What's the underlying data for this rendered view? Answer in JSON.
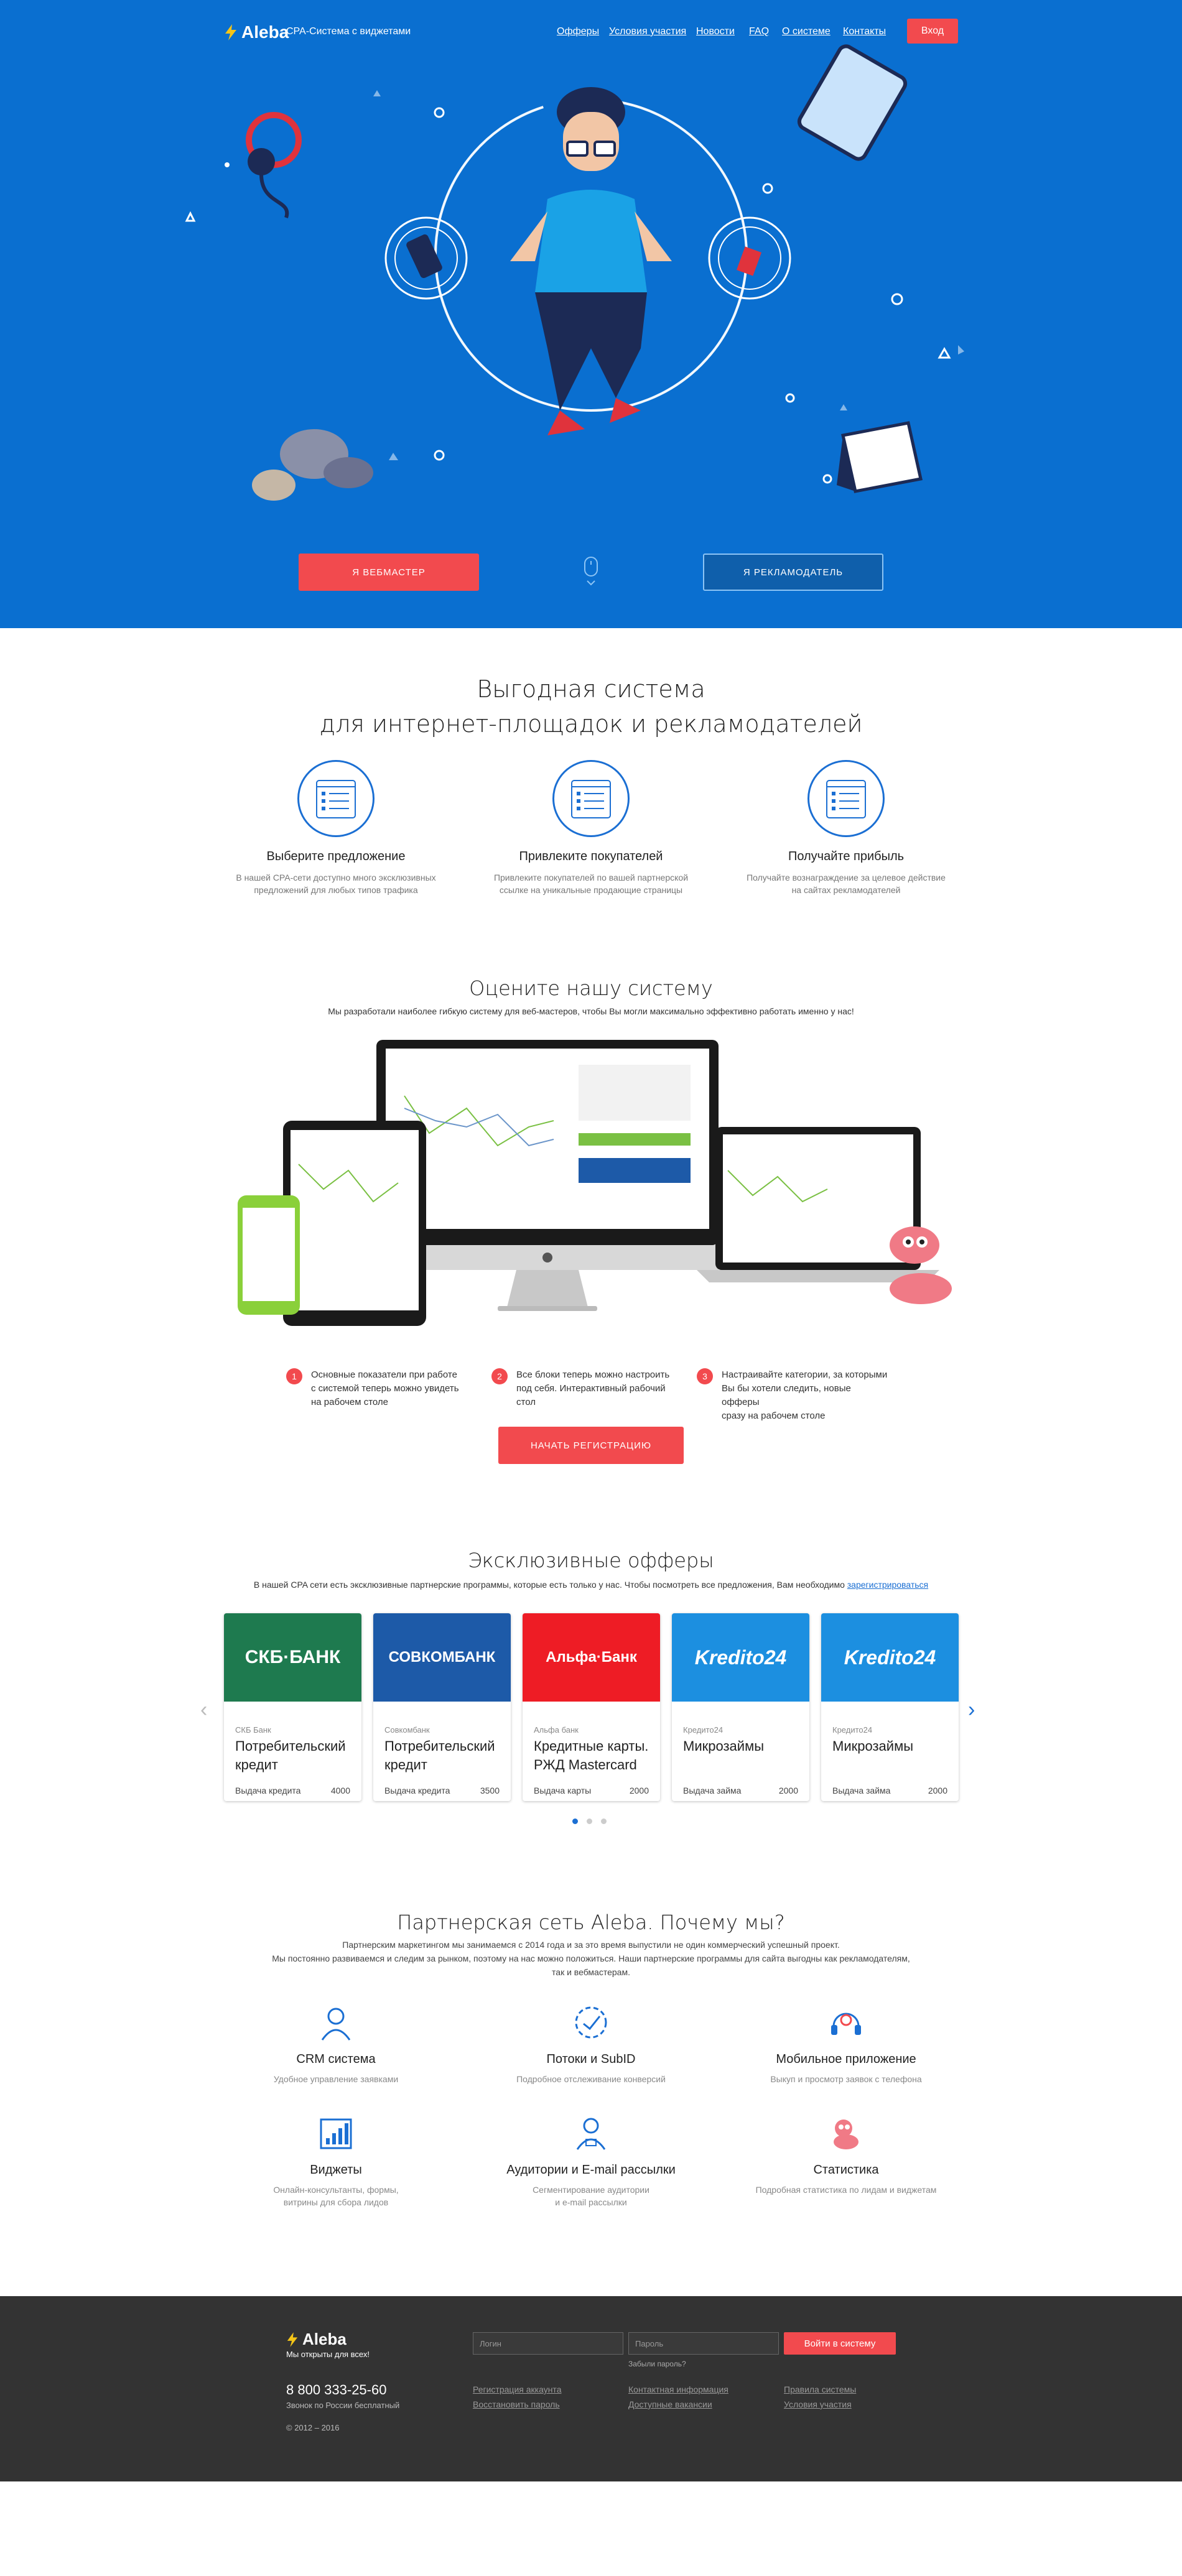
{
  "nav": {
    "logo": "Aleba",
    "tagline": "CPA-Система с виджетами",
    "items": [
      "Офферы",
      "Условия участия",
      "Новости",
      "FAQ",
      "О системе",
      "Контакты"
    ],
    "login": "Вход"
  },
  "hero": {
    "btn_webmaster": "Я ВЕБМАСТЕР",
    "btn_advertiser": "Я РЕКЛАМОДАТЕЛЬ"
  },
  "benefits": {
    "title1": "Выгодная система",
    "title2": "для интернет-площадок и рекламодателей",
    "items": [
      {
        "title": "Выберите предложение",
        "desc1": "В нашей CPA-сети доступно много эксклюзивных",
        "desc2": "предложений для любых типов трафика"
      },
      {
        "title": "Привлеките покупателей",
        "desc1": "Привлеките покупателей по вашей партнерской",
        "desc2": "ссылке на уникальные продающие страницы"
      },
      {
        "title": "Получайте прибыль",
        "desc1": "Получайте вознаграждение за целевое действие",
        "desc2": "на сайтах рекламодателей"
      }
    ]
  },
  "evaluate": {
    "title": "Оцените нашу систему",
    "subtitle": "Мы разработали наиболее гибкую систему для веб-мастеров, чтобы Вы могли максимально эффективно работать именно у нас!",
    "steps": [
      {
        "n": "1",
        "l1": "Основные показатели при работе",
        "l2": "с системой теперь можно увидеть",
        "l3": "на рабочем столе"
      },
      {
        "n": "2",
        "l1": "Все блоки теперь можно настроить",
        "l2": "под себя. Интерактивный рабочий",
        "l3": "стол"
      },
      {
        "n": "3",
        "l1": "Настраивайте категории, за которыми",
        "l2": "Вы бы хотели следить, новые офферы",
        "l3": "сразу на рабочем столе"
      }
    ],
    "register": "НАЧАТЬ РЕГИСТРАЦИЮ"
  },
  "offers": {
    "title": "Эксклюзивные офферы",
    "subtitle": "В нашей CPA сети есть эксклюзивные партнерские программы, которые есть только у нас. Чтобы посмотреть все предложения, Вам необходимо",
    "subtitle_link": "зарегистрироваться",
    "cards": [
      {
        "banner": "СКБ·БАНК",
        "bank": "СКБ Банк",
        "name1": "Потребительский",
        "name2": "кредит",
        "label": "Выдача кредита",
        "value": "4000",
        "color": "#1e7a4f"
      },
      {
        "banner": "СОВКОМБАНК",
        "bank": "Совкомбанк",
        "name1": "Потребительский",
        "name2": "кредит",
        "label": "Выдача кредита",
        "value": "3500",
        "color": "#1d5aa8"
      },
      {
        "banner": "Альфа·Банк",
        "bank": "Альфа банк",
        "name1": "Кредитные карты.",
        "name2": "РЖД Mastercard",
        "label": "Выдача карты",
        "value": "2000",
        "color": "#ee1c25"
      },
      {
        "banner": "Kredito24",
        "bank": "Кредито24",
        "name1": "Микрозаймы",
        "name2": "",
        "label": "Выдача займа",
        "value": "2000",
        "color": "#1c8fe0"
      },
      {
        "banner": "Kredito24",
        "bank": "Кредито24",
        "name1": "Микрозаймы",
        "name2": "",
        "label": "Выдача займа",
        "value": "2000",
        "color": "#1c8fe0"
      }
    ]
  },
  "why": {
    "title": "Партнерская сеть Aleba. Почему мы?",
    "line1": "Партнерским маркетингом мы занимаемся с 2014 года и за это время выпустили не один коммерческий успешный проект.",
    "line2": "Мы постоянно развиваемся и следим за рынком, поэтому на нас можно положиться. Наши партнерские программы для сайта выгодны как рекламодателям,",
    "line3": "так и вебмастерам.",
    "items": [
      {
        "title": "CRM система",
        "d1": "Удобное управление заявками",
        "d2": "",
        "icon": "crm-icon"
      },
      {
        "title": "Потоки и SubID",
        "d1": "Подробное отслеживание конверсий",
        "d2": "",
        "icon": "flow-icon"
      },
      {
        "title": "Мобильное приложение",
        "d1": "Выкуп и просмотр заявок с телефона",
        "d2": "",
        "icon": "headset-icon"
      },
      {
        "title": "Виджеты",
        "d1": "Онлайн-консультанты, формы,",
        "d2": "витрины для сбора лидов",
        "icon": "widget-icon"
      },
      {
        "title": "Аудитории и E-mail рассылки",
        "d1": "Сегментирование аудитории",
        "d2": "и e-mail рассылки",
        "icon": "audience-icon"
      },
      {
        "title": "Статистика",
        "d1": "Подробная статистика по лидам и виджетам",
        "d2": "",
        "icon": "stats-icon"
      }
    ]
  },
  "footer": {
    "logo": "Aleba",
    "slogan": "Мы открыты для всех!",
    "phone": "8 800 333-25-60",
    "phone_note": "Звонок по России бесплатный",
    "copyright": "© 2012 – 2016",
    "login_placeholder": "Логин",
    "password_placeholder": "Пароль",
    "forgot": "Забыли пароль?",
    "login_btn": "Войти в систему",
    "links": [
      "Регистрация аккаунта",
      "Восстановить пароль",
      "Контактная информация",
      "Доступные вакансии",
      "Правила системы",
      "Условия участия"
    ]
  },
  "colors": {
    "hero_blue": "#0a6fd0",
    "accent_red": "#f24a4e",
    "link_blue": "#1b6fd3",
    "footer": "#333333"
  }
}
